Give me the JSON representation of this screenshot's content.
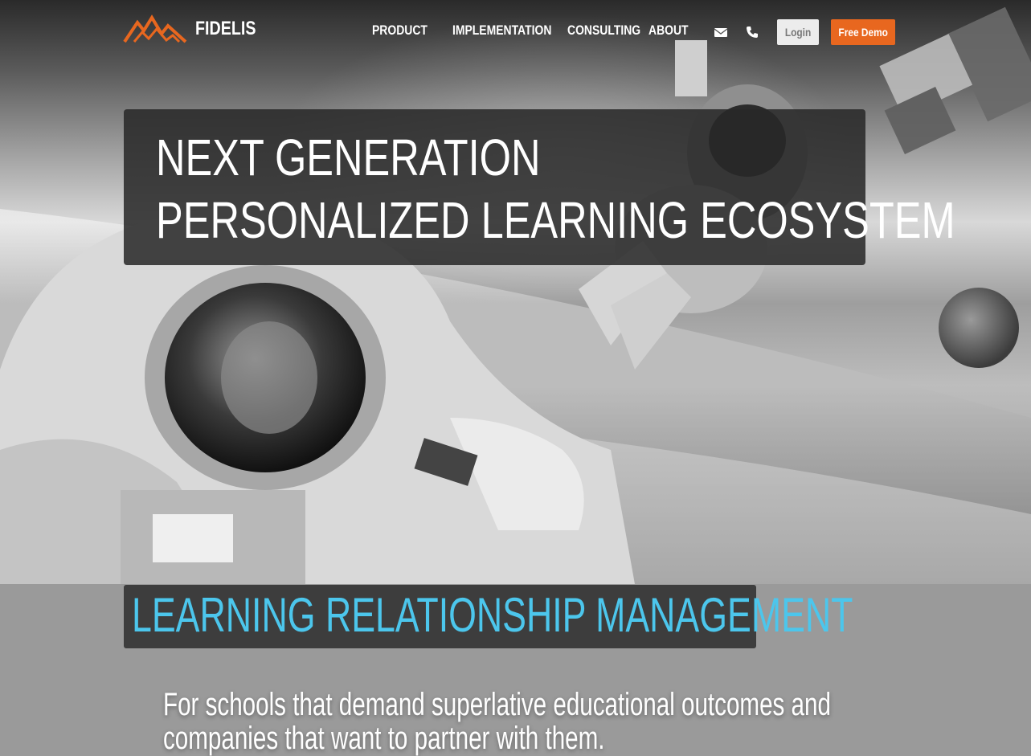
{
  "brand": {
    "name": "FIDELIS",
    "logo_icon": "mountain-logo-icon",
    "accent_color": "#e8671f"
  },
  "nav": {
    "links": [
      "PRODUCT",
      "IMPLEMENTATION",
      "CONSULTING",
      "ABOUT"
    ],
    "email_icon": "envelope-icon",
    "phone_icon": "phone-icon",
    "login_label": "Login",
    "demo_label": "Free Demo"
  },
  "hero": {
    "headline_line1": "NEXT GENERATION",
    "headline_line2": "PERSONALIZED LEARNING ECOSYSTEM"
  },
  "section": {
    "title": "LEARNING RELATIONSHIP MANAGEMENT",
    "title_color": "#4cc6ec",
    "tagline_line1": "For schools that demand superlative educational outcomes and",
    "tagline_line2": "companies that want to partner with them."
  }
}
